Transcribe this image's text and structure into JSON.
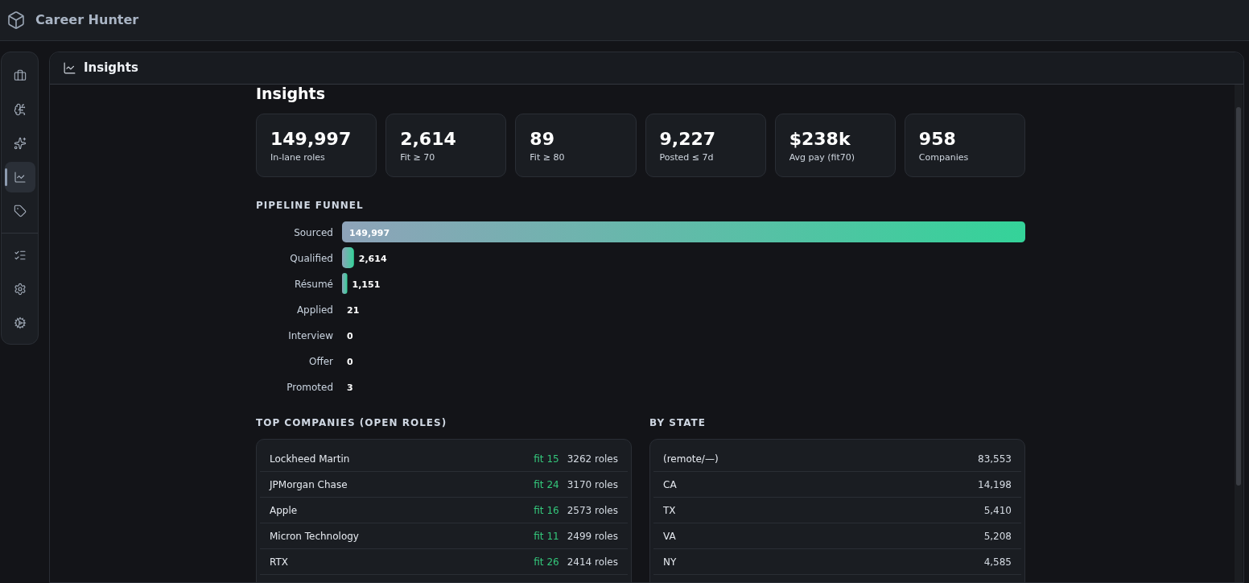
{
  "app": {
    "title": "Career Hunter"
  },
  "sidebar": {
    "groups": [
      [
        {
          "selected": false
        },
        {
          "selected": false
        },
        {
          "selected": false
        },
        {
          "selected": true
        },
        {
          "selected": false
        }
      ],
      [
        {
          "selected": false
        },
        {
          "selected": false
        },
        {
          "selected": false
        }
      ]
    ]
  },
  "panel": {
    "title": "Insights"
  },
  "page": {
    "heading": "Insights"
  },
  "stats": [
    {
      "value": "149,997",
      "label": "In-lane roles"
    },
    {
      "value": "2,614",
      "label": "Fit ≥ 70"
    },
    {
      "value": "89",
      "label": "Fit ≥ 80"
    },
    {
      "value": "9,227",
      "label": "Posted ≤ 7d"
    },
    {
      "value": "$238k",
      "label": "Avg pay (fit70)"
    },
    {
      "value": "958",
      "label": "Companies"
    }
  ],
  "funnel": {
    "heading": "PIPELINE FUNNEL",
    "chart_data": {
      "type": "bar",
      "orientation": "horizontal",
      "data_labels": true,
      "categories": [
        "Sourced",
        "Qualified",
        "Résumé",
        "Applied",
        "Interview",
        "Offer",
        "Promoted"
      ],
      "values": [
        149997,
        2614,
        1151,
        21,
        0,
        0,
        3
      ],
      "value_labels": [
        "149,997",
        "2,614",
        "1,151",
        "21",
        "0",
        "0",
        "3"
      ]
    }
  },
  "top_companies": {
    "heading": "TOP COMPANIES (OPEN ROLES)",
    "rows": [
      {
        "name": "Lockheed Martin",
        "fit": "fit 15",
        "roles": "3262 roles"
      },
      {
        "name": "JPMorgan Chase",
        "fit": "fit 24",
        "roles": "3170 roles"
      },
      {
        "name": "Apple",
        "fit": "fit 16",
        "roles": "2573 roles"
      },
      {
        "name": "Micron Technology",
        "fit": "fit 11",
        "roles": "2499 roles"
      },
      {
        "name": "RTX",
        "fit": "fit 26",
        "roles": "2414 roles"
      }
    ]
  },
  "by_state": {
    "heading": "BY STATE",
    "rows": [
      {
        "state": "(remote/—)",
        "count": "83,553"
      },
      {
        "state": "CA",
        "count": "14,198"
      },
      {
        "state": "TX",
        "count": "5,410"
      },
      {
        "state": "VA",
        "count": "5,208"
      },
      {
        "state": "NY",
        "count": "4,585"
      }
    ]
  }
}
